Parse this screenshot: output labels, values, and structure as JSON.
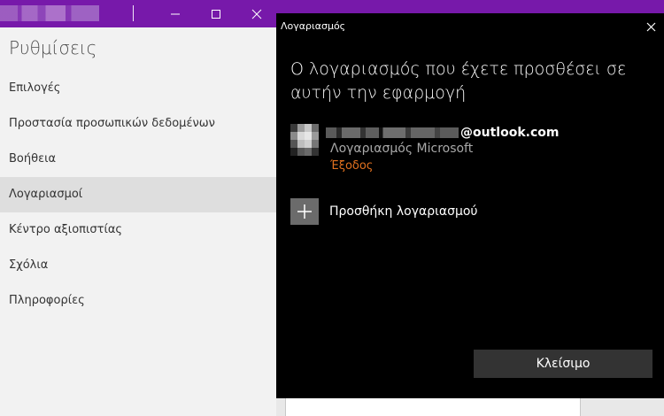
{
  "settings": {
    "title": "Ρυθμίσεις",
    "nav_items": [
      {
        "label": "Επιλογές"
      },
      {
        "label": "Προστασία προσωπικών δεδομένων"
      },
      {
        "label": "Βοήθεια"
      },
      {
        "label": "Λογαριασμοί",
        "selected": true
      },
      {
        "label": "Κέντρο αξιοπιστίας"
      },
      {
        "label": "Σχόλια"
      },
      {
        "label": "Πληροφορίες"
      }
    ]
  },
  "dialog": {
    "title": "Λογαριασμός",
    "heading": "Ο λογαριασμός που έχετε προσθέσει σε αυτήν την εφαρμογή",
    "account": {
      "email_domain": "@outlook.com",
      "type": "Λογαριασμός Microsoft",
      "signout": "Έξοδος"
    },
    "add_account": "Προσθήκη λογαριασμού",
    "close_button": "Κλείσιμο"
  },
  "colors": {
    "accent_purple": "#7719aa",
    "signout_orange": "#e1711f",
    "dialog_bg": "#000000"
  },
  "icons": {
    "window_minimize": "minimize-icon",
    "window_maximize": "maximize-icon",
    "window_close": "close-icon",
    "dialog_close": "close-icon",
    "add": "plus-icon"
  }
}
